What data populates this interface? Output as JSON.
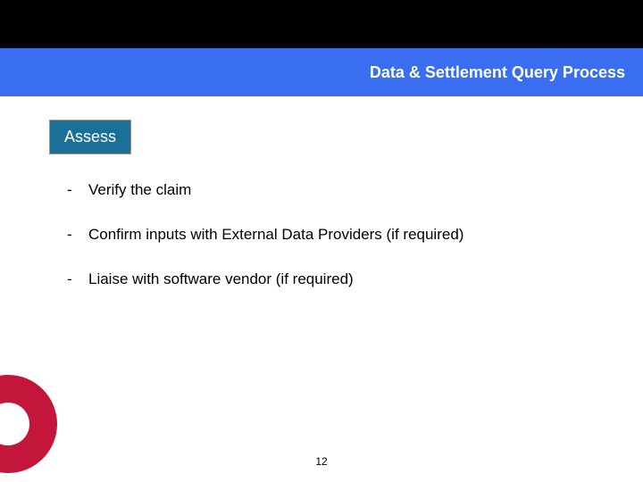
{
  "header": {
    "title": "Data & Settlement Query Process"
  },
  "tag": {
    "label": "Assess"
  },
  "bullets": {
    "dash": "-",
    "items": [
      "Verify the claim",
      "Confirm inputs with External Data Providers (if required)",
      "Liaise with software vendor (if required)"
    ]
  },
  "page_number": "12"
}
